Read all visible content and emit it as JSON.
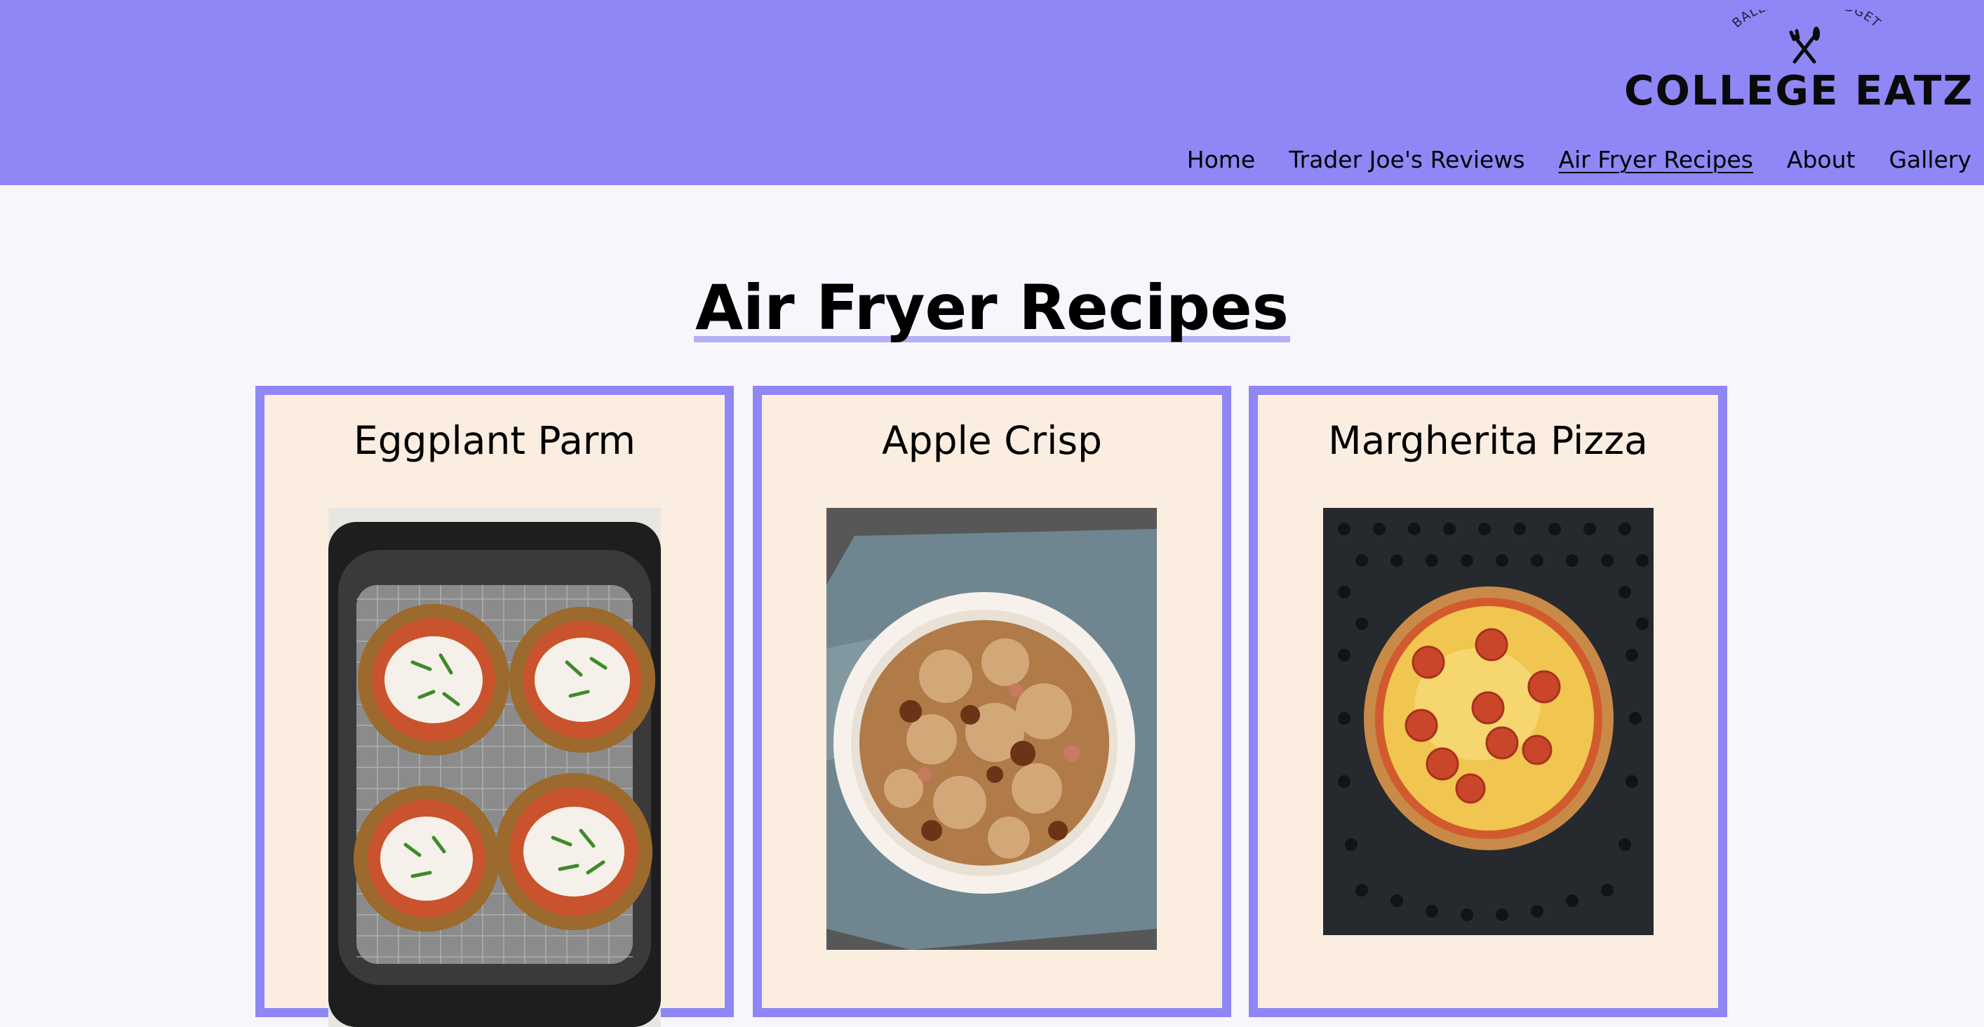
{
  "header": {
    "brand_tagline": "BALLIN ON A BUDGET",
    "brand_title": "COLLEGE EATZ",
    "brand_color": "#8f87f5",
    "nav": [
      {
        "label": "Home",
        "active": false
      },
      {
        "label": "Trader Joe's Reviews",
        "active": false
      },
      {
        "label": "Air Fryer Recipes",
        "active": true
      },
      {
        "label": "About",
        "active": false
      },
      {
        "label": "Gallery",
        "active": false
      }
    ]
  },
  "main": {
    "title": "Air Fryer Recipes",
    "cards": [
      {
        "title": "Eggplant Parm",
        "image": "eggplant-parm-photo"
      },
      {
        "title": "Apple Crisp",
        "image": "apple-crisp-photo"
      },
      {
        "title": "Margherita Pizza",
        "image": "margherita-pizza-photo"
      }
    ],
    "card_background": "#fbeee1"
  }
}
